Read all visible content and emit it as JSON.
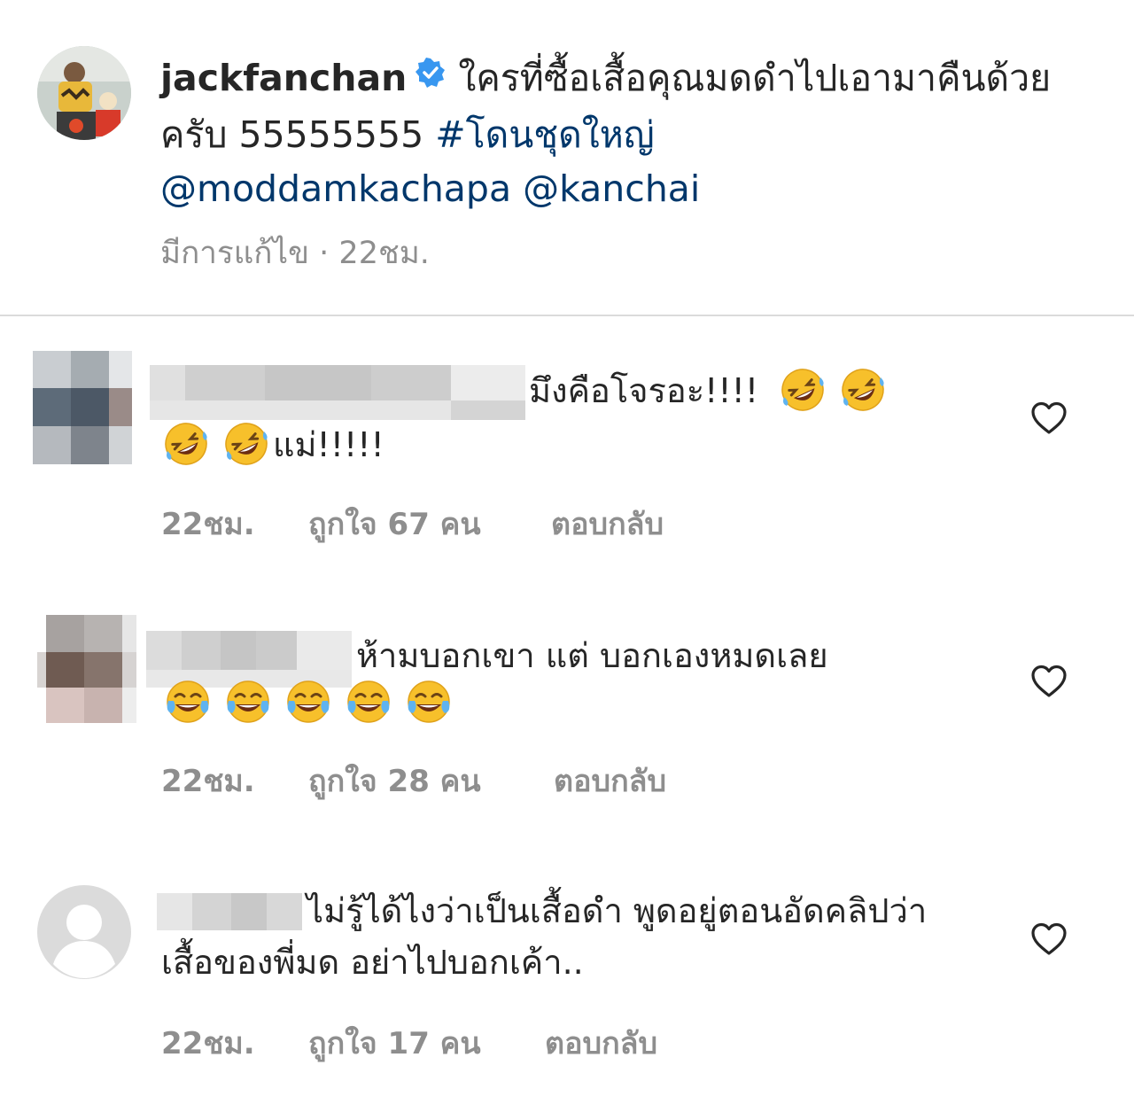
{
  "post": {
    "username": "jackfanchan",
    "caption_text": "ใครที่ซื้อเสื้อคุณมดดำไปเอามาคืนด้วยครับ 55555555",
    "hashtag": "#โดนชุดใหญ่",
    "mentions": [
      "@moddamkachapa",
      "@kanchai"
    ],
    "edited_label": "มีการแก้ไข",
    "separator": "·",
    "time": "22ชม."
  },
  "comments": [
    {
      "text": "มึงคือโจรอะ!!!!",
      "text_after_emoji": "แม่!!!!!",
      "emoji": [
        "rofl",
        "rofl",
        "rofl",
        "rofl"
      ],
      "time": "22ชม.",
      "likes": "ถูกใจ 67 คน",
      "reply": "ตอบกลับ"
    },
    {
      "text": "ห้ามบอกเขา แต่ บอกเองหมดเลย",
      "emoji": [
        "joy",
        "joy",
        "joy",
        "joy",
        "joy"
      ],
      "time": "22ชม.",
      "likes": "ถูกใจ 28 คน",
      "reply": "ตอบกลับ"
    },
    {
      "text": "ไม่รู้ได้ไงว่าเป็นเสื้อดำ พูดอยู่ตอนอัดคลิปว่าเสื้อของพี่มด อย่าไปบอกเค้า..",
      "time": "22ชม.",
      "likes": "ถูกใจ 17 คน",
      "reply": "ตอบกลับ"
    }
  ],
  "icons": {
    "verified": "verified-badge-icon",
    "heart": "heart-outline-icon",
    "default_avatar": "default-avatar-icon"
  },
  "colors": {
    "verified_blue": "#3897f0",
    "link": "#00376b",
    "meta_gray": "#8e8e8e",
    "divider": "#dbdbdb"
  }
}
